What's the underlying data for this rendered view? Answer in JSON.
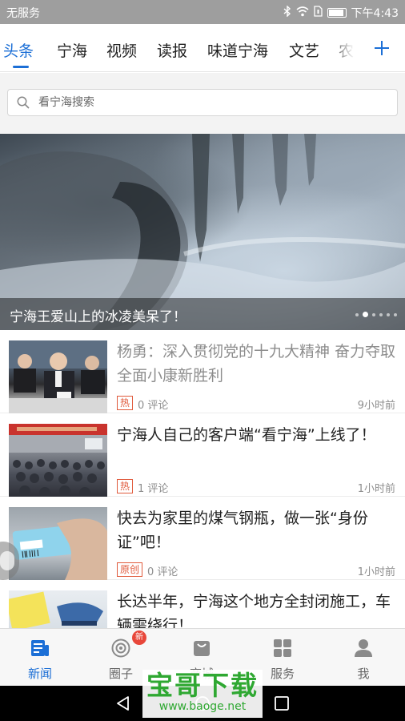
{
  "status_bar": {
    "carrier": "无服务",
    "time": "下午4:43"
  },
  "tabs": {
    "items": [
      {
        "label": "头条",
        "active": true
      },
      {
        "label": "宁海"
      },
      {
        "label": "视频"
      },
      {
        "label": "读报"
      },
      {
        "label": "味道宁海"
      },
      {
        "label": "文艺"
      },
      {
        "label": "农"
      }
    ],
    "add_icon": "plus-icon"
  },
  "search": {
    "placeholder": "看宁海搜索",
    "icon": "search-icon"
  },
  "banner": {
    "title": "宁海王爱山上的冰凌美呆了！",
    "dots_total": 6,
    "active_dot": 1
  },
  "news": [
    {
      "title": "杨勇：深入贯彻党的十九大精神 奋力夺取全面小康新胜利",
      "read": true,
      "tag": "热",
      "comments": "0 评论",
      "time": "9小时前"
    },
    {
      "title": "宁海人自己的客户端“看宁海”上线了！",
      "read": false,
      "tag": "热",
      "comments": "1 评论",
      "time": "1小时前"
    },
    {
      "title": "快去为家里的煤气钢瓶，做一张“身份证”吧！",
      "read": false,
      "tag": "原创",
      "comments": "0 评论",
      "time": "1小时前"
    },
    {
      "title": "长达半年，宁海这个地方全封闭施工，车辆需绕行！",
      "read": false
    }
  ],
  "bottom_nav": {
    "items": [
      {
        "label": "新闻",
        "icon": "news-icon",
        "active": true
      },
      {
        "label": "圈子",
        "icon": "circle-icon",
        "badge": "新"
      },
      {
        "label": "商城",
        "icon": "shopping-bag-icon"
      },
      {
        "label": "服务",
        "icon": "grid-icon"
      },
      {
        "label": "我",
        "icon": "user-icon"
      }
    ]
  },
  "watermark": {
    "brand": "宝哥下载",
    "url": "www.baoge.net"
  },
  "colors": {
    "accent": "#1c6fd6",
    "tag": "#e05a3c",
    "badge": "#e8473a",
    "watermark": "#2fa832"
  }
}
